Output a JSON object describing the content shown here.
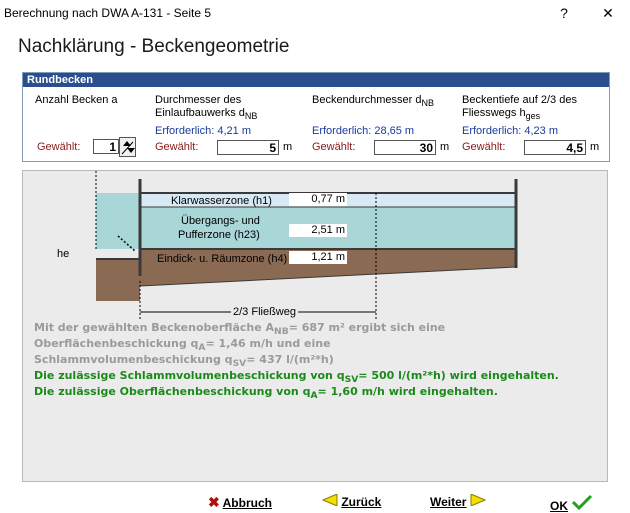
{
  "window": {
    "title": "Berechnung nach DWA A-131 - Seite 5",
    "help_label": "?",
    "close_label": "✕"
  },
  "page_title": "Nachklärung - Beckengeometrie",
  "group": {
    "header": "Rundbecken",
    "anzahl": {
      "label": "Anzahl Becken a",
      "gewaehlt_label": "Gewählt:",
      "value": "1"
    },
    "einlauf": {
      "label1": "Durchmesser des",
      "label2": "Einlaufbauwerks d",
      "label_sub": "NB",
      "erforderlich": "Erforderlich:  4,21 m",
      "gewaehlt_label": "Gewählt:",
      "value": "5",
      "unit": "m"
    },
    "becken": {
      "label": "Beckendurchmesser d",
      "label_sub": "NB",
      "erforderlich": "Erforderlich: 28,65 m",
      "gewaehlt_label": "Gewählt:",
      "value": "30",
      "unit": "m"
    },
    "tiefe": {
      "label1": "Beckentiefe auf 2/3 des",
      "label2": "Fliesswegs h",
      "label_sub": "ges",
      "erforderlich": "Erforderlich: 4,23 m",
      "gewaehlt_label": "Gewählt:",
      "value": "4,5",
      "unit": "m"
    }
  },
  "diagram": {
    "he_label": "he",
    "zone1": {
      "label": "Klarwasserzone (h1)",
      "value": "0,77 m"
    },
    "zone2": {
      "label1": "Übergangs- und",
      "label2": "Pufferzone (h23)",
      "value": "2,51 m"
    },
    "zone3": {
      "label": "Eindick- u. Räumzone (h4)",
      "value": "1,21 m"
    },
    "flow_label": "2/3 Fließweg",
    "colors": {
      "water": "#a9d6d6",
      "clear": "#d6e9f4",
      "sludge": "#8a6a52",
      "wall": "#3a3a3a"
    }
  },
  "info": {
    "line1a": "Mit der gewählten Beckenoberfläche A",
    "line1sub": "NB",
    "line1b": "=  687 m² ergibt sich eine",
    "line2a": "Oberflächenbeschickung q",
    "line2sub": "A",
    "line2b": "= 1,46 m/h und eine",
    "line3a": "Schlammvolumenbeschickung q",
    "line3sub": "SV",
    "line3b": "=  437 l/(m²*h)",
    "ok1a": "Die zulässige Schlammvolumenbeschickung von q",
    "ok1sub": "SV",
    "ok1b": "=  500 l/(m²*h) wird eingehalten.",
    "ok2a": "Die zulässige Oberflächenbeschickung von q",
    "ok2sub": "A",
    "ok2b": "= 1,60 m/h wird eingehalten."
  },
  "buttons": {
    "abbruch": "Abbruch",
    "zurueck": "Zurück",
    "weiter": "Weiter",
    "ok": "OK"
  }
}
